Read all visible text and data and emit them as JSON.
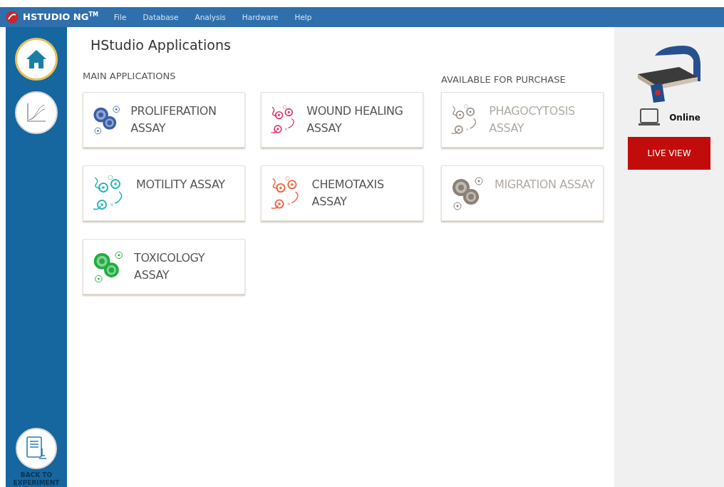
{
  "app": {
    "name": "HSTUDIO NG",
    "mark": "TM"
  },
  "menu": [
    "File",
    "Database",
    "Analysis",
    "Hardware",
    "Help"
  ],
  "sidebar": {
    "items": [
      {
        "kind": "home",
        "selected": true
      },
      {
        "kind": "chart",
        "selected": false
      }
    ],
    "back": {
      "label": "BACK TO EXPERIMENT"
    }
  },
  "title": "HStudio Applications",
  "main_applications": {
    "heading": "MAIN APPLICATIONS",
    "items": [
      {
        "label": "PROLIFERATION ASSAY",
        "kind": "cells",
        "color": "#3a5fa8",
        "available": true
      },
      {
        "label": "WOUND HEALING ASSAY",
        "kind": "swirl",
        "color": "#e0245e",
        "available": true
      },
      {
        "label": "MOTILITY ASSAY",
        "kind": "swirl",
        "color": "#2bb3b8",
        "available": true
      },
      {
        "label": "CHEMOTAXIS ASSAY",
        "kind": "swirl",
        "color": "#f0643a",
        "available": true
      },
      {
        "label": "TOXICOLOGY ASSAY",
        "kind": "cells",
        "color": "#1fae3f",
        "available": true
      }
    ]
  },
  "available_for_purchase": {
    "heading": "AVAILABLE FOR PURCHASE",
    "items": [
      {
        "label": "PHAGOCYTOSIS ASSAY",
        "kind": "swirl",
        "color": "#9a9288",
        "available": false
      },
      {
        "label": "MIGRATION ASSAY",
        "kind": "cells",
        "color": "#8a8074",
        "available": false
      }
    ]
  },
  "device": {
    "status": "Online",
    "online": true
  },
  "live_view": {
    "label": "LIVE VIEW"
  }
}
